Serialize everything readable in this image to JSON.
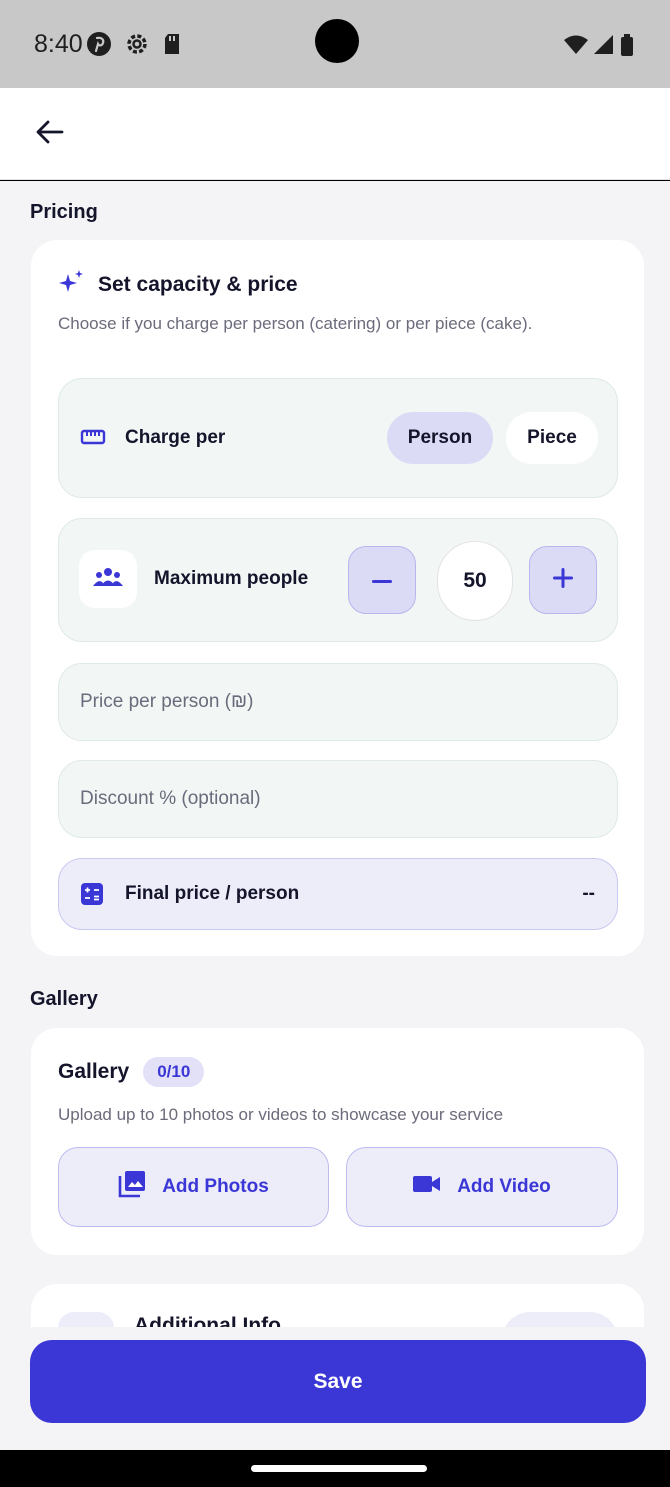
{
  "status_bar": {
    "time": "8:40",
    "left_icons": [
      "pinterest-icon",
      "settings-gear-icon",
      "sd-card-icon"
    ],
    "right_icons": [
      "wifi-icon",
      "signal-icon",
      "battery-icon"
    ]
  },
  "app_bar": {
    "back_icon": "arrow-left-icon"
  },
  "pricing": {
    "section_title": "Pricing",
    "card": {
      "icon": "sparkles-icon",
      "title": "Set capacity & price",
      "description": "Choose if you charge per person (catering) or per piece (cake).",
      "charge_per": {
        "icon": "ruler-icon",
        "label": "Charge per",
        "options": [
          "Person",
          "Piece"
        ],
        "selected": "Person"
      },
      "max_people": {
        "icon": "group-icon",
        "label": "Maximum people",
        "decrement": "−",
        "value": "50",
        "increment": "+"
      },
      "price_field": {
        "placeholder": "Price per person (₪)",
        "value": ""
      },
      "discount_field": {
        "placeholder": "Discount % (optional)",
        "value": ""
      },
      "final_price": {
        "icon": "calculator-icon",
        "label": "Final price / person",
        "value": "--"
      }
    }
  },
  "gallery": {
    "section_title": "Gallery",
    "card": {
      "title": "Gallery",
      "count_badge": "0/10",
      "description": "Upload up to 10 photos or videos to showcase your service",
      "add_photos": {
        "icon": "photo-library-icon",
        "label": "Add Photos"
      },
      "add_video": {
        "icon": "video-camera-icon",
        "label": "Add Video"
      }
    }
  },
  "additional_info": {
    "title": "Additional Info"
  },
  "footer": {
    "save_label": "Save"
  },
  "colors": {
    "accent": "#3b36d6",
    "accent_light": "#dcdbf6",
    "page_bg": "#f4f4f7",
    "field_bg": "#f2f7f6",
    "status_bar_bg": "#c8c8c8"
  }
}
